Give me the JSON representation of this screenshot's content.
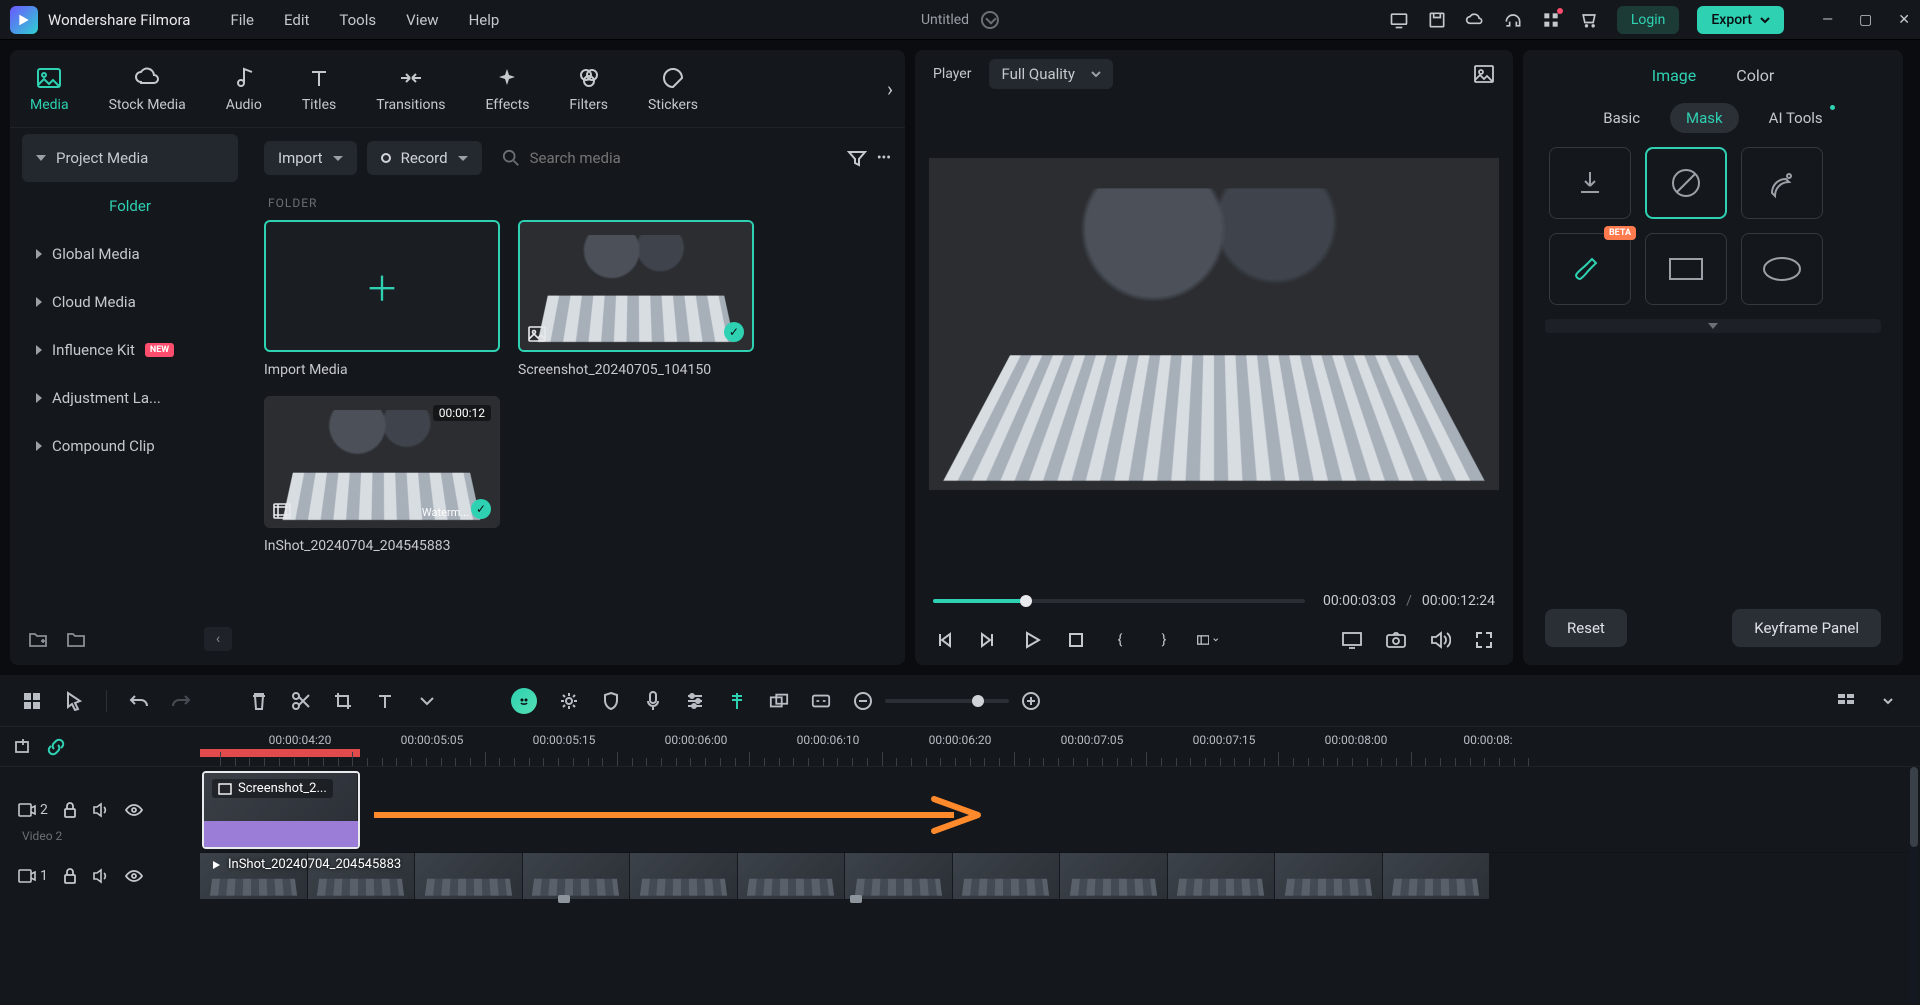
{
  "app": {
    "name": "Wondershare Filmora",
    "title": "Untitled",
    "login": "Login",
    "export": "Export"
  },
  "menu": [
    "File",
    "Edit",
    "Tools",
    "View",
    "Help"
  ],
  "top_tabs": [
    {
      "id": "media",
      "label": "Media"
    },
    {
      "id": "stock",
      "label": "Stock Media"
    },
    {
      "id": "audio",
      "label": "Audio"
    },
    {
      "id": "titles",
      "label": "Titles"
    },
    {
      "id": "transitions",
      "label": "Transitions"
    },
    {
      "id": "effects",
      "label": "Effects"
    },
    {
      "id": "filters",
      "label": "Filters"
    },
    {
      "id": "stickers",
      "label": "Stickers"
    }
  ],
  "sidebar": [
    {
      "id": "project",
      "label": "Project Media",
      "active": true
    },
    {
      "id": "folder",
      "label": "Folder",
      "sub": true
    },
    {
      "id": "global",
      "label": "Global Media"
    },
    {
      "id": "cloud",
      "label": "Cloud Media"
    },
    {
      "id": "influence",
      "label": "Influence Kit",
      "chip": "NEW"
    },
    {
      "id": "adjustment",
      "label": "Adjustment La..."
    },
    {
      "id": "compound",
      "label": "Compound Clip"
    }
  ],
  "media_toolbar": {
    "import": "Import",
    "record": "Record",
    "search_ph": "Search media"
  },
  "folder_label": "FOLDER",
  "media": [
    {
      "id": "import",
      "name": "Import Media",
      "kind": "add"
    },
    {
      "id": "m1",
      "name": "Screenshot_20240705_104150",
      "kind": "image",
      "selected": true
    },
    {
      "id": "m2",
      "name": "InShot_20240704_204545883",
      "kind": "video",
      "dur": "00:00:12",
      "selected": true,
      "wm": "Waterm..."
    }
  ],
  "player": {
    "label": "Player",
    "quality": "Full Quality",
    "cur": "00:00:03:03",
    "total": "00:00:12:24"
  },
  "right": {
    "tabs": [
      "Image",
      "Color"
    ],
    "subtabs": [
      "Basic",
      "Mask",
      "AI Tools"
    ],
    "masks": [
      "import",
      "none",
      "pen",
      "brush",
      "rect",
      "ellipse"
    ],
    "beta": "BETA",
    "reset": "Reset",
    "keyframe": "Keyframe Panel"
  },
  "ruler": [
    "00:00:04:20",
    "00:00:05:05",
    "00:00:05:15",
    "00:00:06:00",
    "00:00:06:10",
    "00:00:06:20",
    "00:00:07:05",
    "00:00:07:15",
    "00:00:08:00",
    "00:00:08:"
  ],
  "tracks": {
    "v2": {
      "num": "2",
      "name": "Video 2",
      "clip": "Screenshot_2..."
    },
    "v1": {
      "num": "1",
      "clip": "InShot_20240704_204545883"
    }
  }
}
